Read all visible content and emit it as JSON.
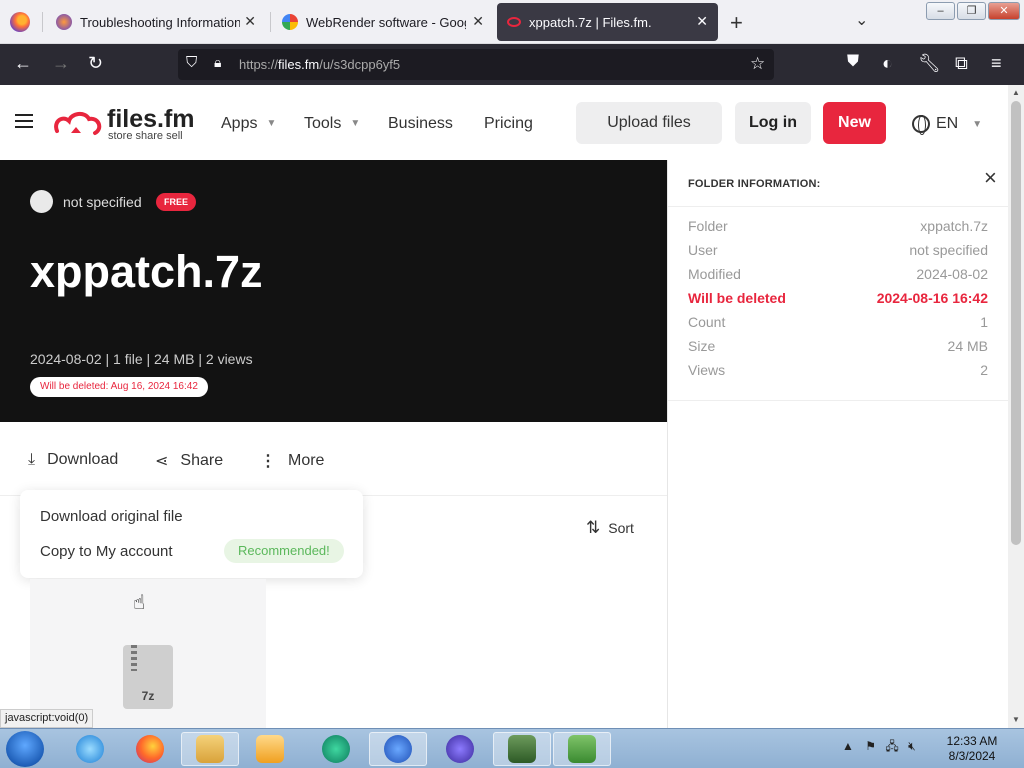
{
  "browser": {
    "tabs": [
      {
        "title": "Troubleshooting Information",
        "active": false
      },
      {
        "title": "WebRender software - Google S",
        "active": false
      },
      {
        "title": "xppatch.7z | Files.fm.",
        "active": true
      }
    ],
    "url_prefix": "https://",
    "url_host": "files.fm",
    "url_path": "/u/s3dcpp6yf5"
  },
  "header": {
    "logo_name": "files.fm",
    "logo_tagline": "store share sell",
    "nav": [
      "Apps",
      "Tools",
      "Business",
      "Pricing"
    ],
    "upload_label": "Upload files",
    "login_label": "Log in",
    "new_label": "New",
    "language": "EN"
  },
  "hero": {
    "owner": "not specified",
    "plan_badge": "FREE",
    "title": "xppatch.7z",
    "meta": "2024-08-02 | 1 file | 24 MB | 2 views",
    "delete_notice": "Will be deleted: Aug 16, 2024 16:42"
  },
  "actions": {
    "download": "Download",
    "share": "Share",
    "more": "More",
    "sort": "Sort"
  },
  "dropdown": {
    "item1": "Download original file",
    "item2": "Copy to My account",
    "badge": "Recommended!"
  },
  "file": {
    "ext": "7z"
  },
  "panel": {
    "title": "FOLDER INFORMATION:",
    "rows": [
      {
        "key": "Folder",
        "value": "xppatch.7z"
      },
      {
        "key": "User",
        "value": "not specified"
      },
      {
        "key": "Modified",
        "value": "2024-08-02"
      },
      {
        "key": "Will be deleted",
        "value": "2024-08-16 16:42"
      },
      {
        "key": "Count",
        "value": "1"
      },
      {
        "key": "Size",
        "value": "24 MB"
      },
      {
        "key": "Views",
        "value": "2"
      }
    ]
  },
  "status_link": "javascript:void(0)",
  "taskbar": {
    "time": "12:33 AM",
    "date": "8/3/2024"
  },
  "colors": {
    "accent_red": "#e8263e",
    "hero_bg": "#121212",
    "browser_dark": "#2b2a33"
  }
}
